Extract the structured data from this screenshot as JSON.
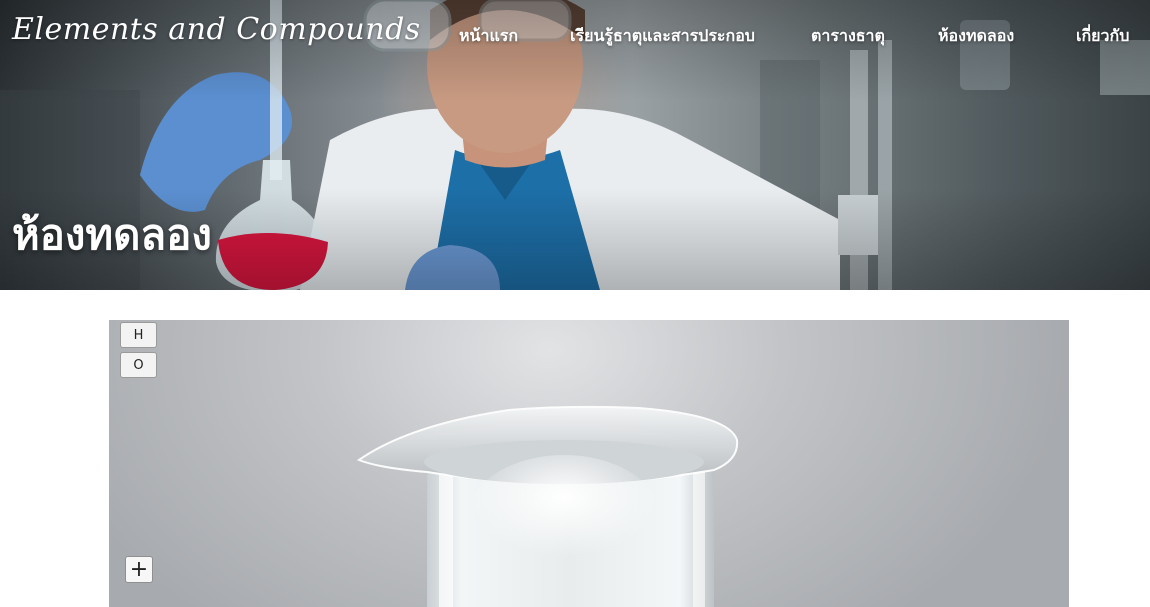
{
  "header": {
    "logo": "Elements and Compounds",
    "nav": [
      {
        "label": "หน้าแรก"
      },
      {
        "label": "เรียนรู้ธาตุและสารประกอบ"
      },
      {
        "label": "ตารางธาตุ"
      },
      {
        "label": "ห้องทดลอง"
      },
      {
        "label": "เกี่ยวกับ"
      }
    ]
  },
  "hero": {
    "title": "ห้องทดลอง"
  },
  "lab": {
    "elements": [
      {
        "symbol": "H"
      },
      {
        "symbol": "O"
      }
    ],
    "add_label": "+"
  }
}
